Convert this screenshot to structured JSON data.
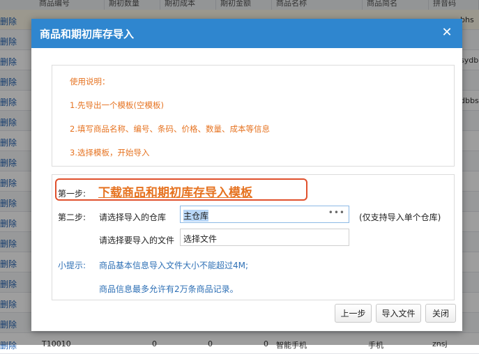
{
  "background": {
    "headers": [
      "商品编号",
      "期初数量",
      "期初成本",
      "期初金额",
      "商品名称",
      "商品简名",
      "拼音码"
    ],
    "delete_label": "删除",
    "side_values": [
      "bhs",
      "",
      "sydb",
      "",
      "dbbs",
      "",
      "",
      "",
      "",
      "",
      "",
      "",
      "",
      "",
      "",
      ""
    ],
    "last_row": {
      "code": "T10010",
      "qty": "0",
      "cost": "0",
      "amount": "0",
      "name": "智能手机",
      "short": "手机",
      "pinyin": "znsj"
    }
  },
  "dialog": {
    "title": "商品和期初库存导入",
    "instructions": {
      "heading": "使用说明：",
      "items": [
        "1.先导出一个模板(空模板)",
        "2.填写商品名称、编号、条码、价格、数量、成本等信息",
        "3.选择模板，开始导入"
      ]
    },
    "step1": {
      "label": "第一步:",
      "link": "下载商品和期初库存导入模板"
    },
    "step2": {
      "label": "第二步:",
      "warehouse_label": "请选择导入的仓库",
      "warehouse_value": "主仓库",
      "warehouse_note": "(仅支持导入单个仓库)",
      "file_label": "请选择要导入的文件",
      "file_value": "选择文件"
    },
    "tips": {
      "label": "小提示:",
      "lines": [
        "商品基本信息导入文件大小不能超过4M;",
        "商品信息最多允许有2万条商品记录。"
      ]
    },
    "buttons": {
      "prev": "上一步",
      "import": "导入文件",
      "close": "关闭"
    }
  }
}
